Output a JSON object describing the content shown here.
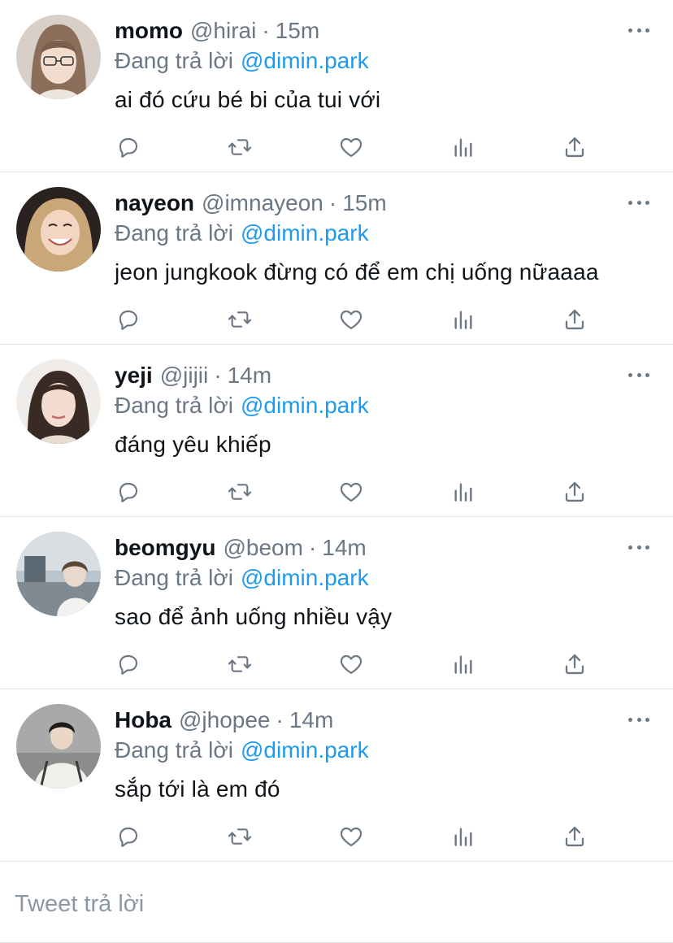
{
  "replies": [
    {
      "name": "momo",
      "handle": "@hirai",
      "time": "15m",
      "reply_prefix": "Đang trả lời",
      "mention": "@dimin.park",
      "text": "ai đó cứu bé bi của tui với"
    },
    {
      "name": "nayeon",
      "handle": "@imnayeon",
      "time": "15m",
      "reply_prefix": "Đang trả lời",
      "mention": "@dimin.park",
      "text": "jeon jungkook đừng có để em chị uống nữaaaa"
    },
    {
      "name": "yeji",
      "handle": "@jijii",
      "time": "14m",
      "reply_prefix": "Đang trả lời",
      "mention": "@dimin.park",
      "text": "đáng yêu khiếp"
    },
    {
      "name": "beomgyu",
      "handle": "@beom",
      "time": "14m",
      "reply_prefix": "Đang trả lời",
      "mention": "@dimin.park",
      "text": "sao để ảnh uống nhiều vậy"
    },
    {
      "name": "Hoba",
      "handle": "@jhopee",
      "time": "14m",
      "reply_prefix": "Đang trả lời",
      "mention": "@dimin.park",
      "text": "sắp tới là em đó"
    }
  ],
  "separator": "·",
  "icons": {
    "reply": "reply-icon",
    "retweet": "retweet-icon",
    "like": "like-icon",
    "stats": "stats-icon",
    "share": "share-icon",
    "more": "more-icon"
  },
  "compose": {
    "placeholder": "Tweet trả lời"
  },
  "colors": {
    "link": "#1d9bf0",
    "secondary": "#6b7784",
    "text": "#0f1419",
    "divider": "#dfe3e7"
  }
}
